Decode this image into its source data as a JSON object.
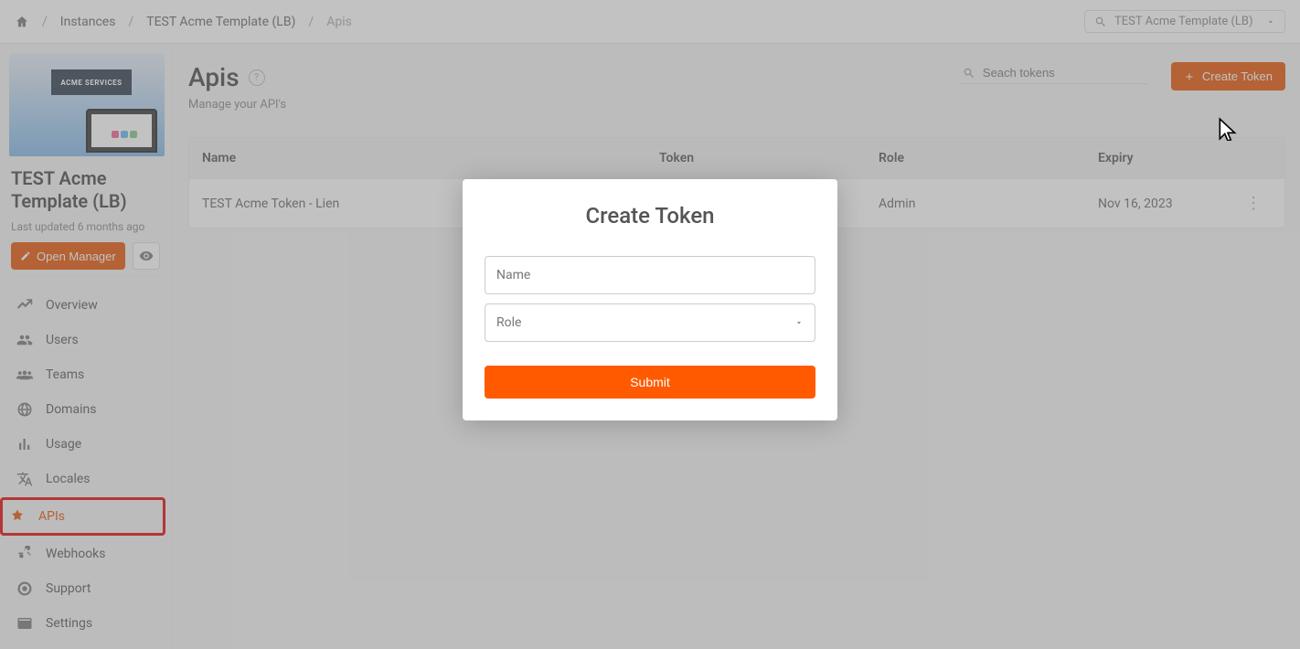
{
  "breadcrumb": {
    "items": [
      "Instances",
      "TEST Acme Template (LB)",
      "Apis"
    ]
  },
  "top_search": {
    "label": "TEST Acme Template (LB)"
  },
  "project": {
    "banner": "ACME SERVICES",
    "title": "TEST Acme Template (LB)",
    "updated": "Last updated 6 months ago",
    "open_manager": "Open Manager"
  },
  "nav": {
    "items": [
      {
        "label": "Overview",
        "icon": "overview"
      },
      {
        "label": "Users",
        "icon": "users"
      },
      {
        "label": "Teams",
        "icon": "teams"
      },
      {
        "label": "Domains",
        "icon": "domains"
      },
      {
        "label": "Usage",
        "icon": "usage"
      },
      {
        "label": "Locales",
        "icon": "locales"
      },
      {
        "label": "APIs",
        "icon": "apis",
        "active": true
      },
      {
        "label": "Webhooks",
        "icon": "webhooks"
      },
      {
        "label": "Support",
        "icon": "support"
      },
      {
        "label": "Settings",
        "icon": "settings"
      }
    ]
  },
  "page": {
    "title": "Apis",
    "subtitle": "Manage your API's",
    "search_placeholder": "Seach tokens",
    "create_label": "Create Token"
  },
  "table": {
    "cols": [
      "Name",
      "Token",
      "Role",
      "Expiry"
    ],
    "rows": [
      {
        "name": "TEST Acme Token - Lien",
        "token": "",
        "role": "Admin",
        "expiry": "Nov 16, 2023"
      }
    ]
  },
  "modal": {
    "title": "Create Token",
    "name_label": "Name",
    "role_label": "Role",
    "submit": "Submit"
  }
}
